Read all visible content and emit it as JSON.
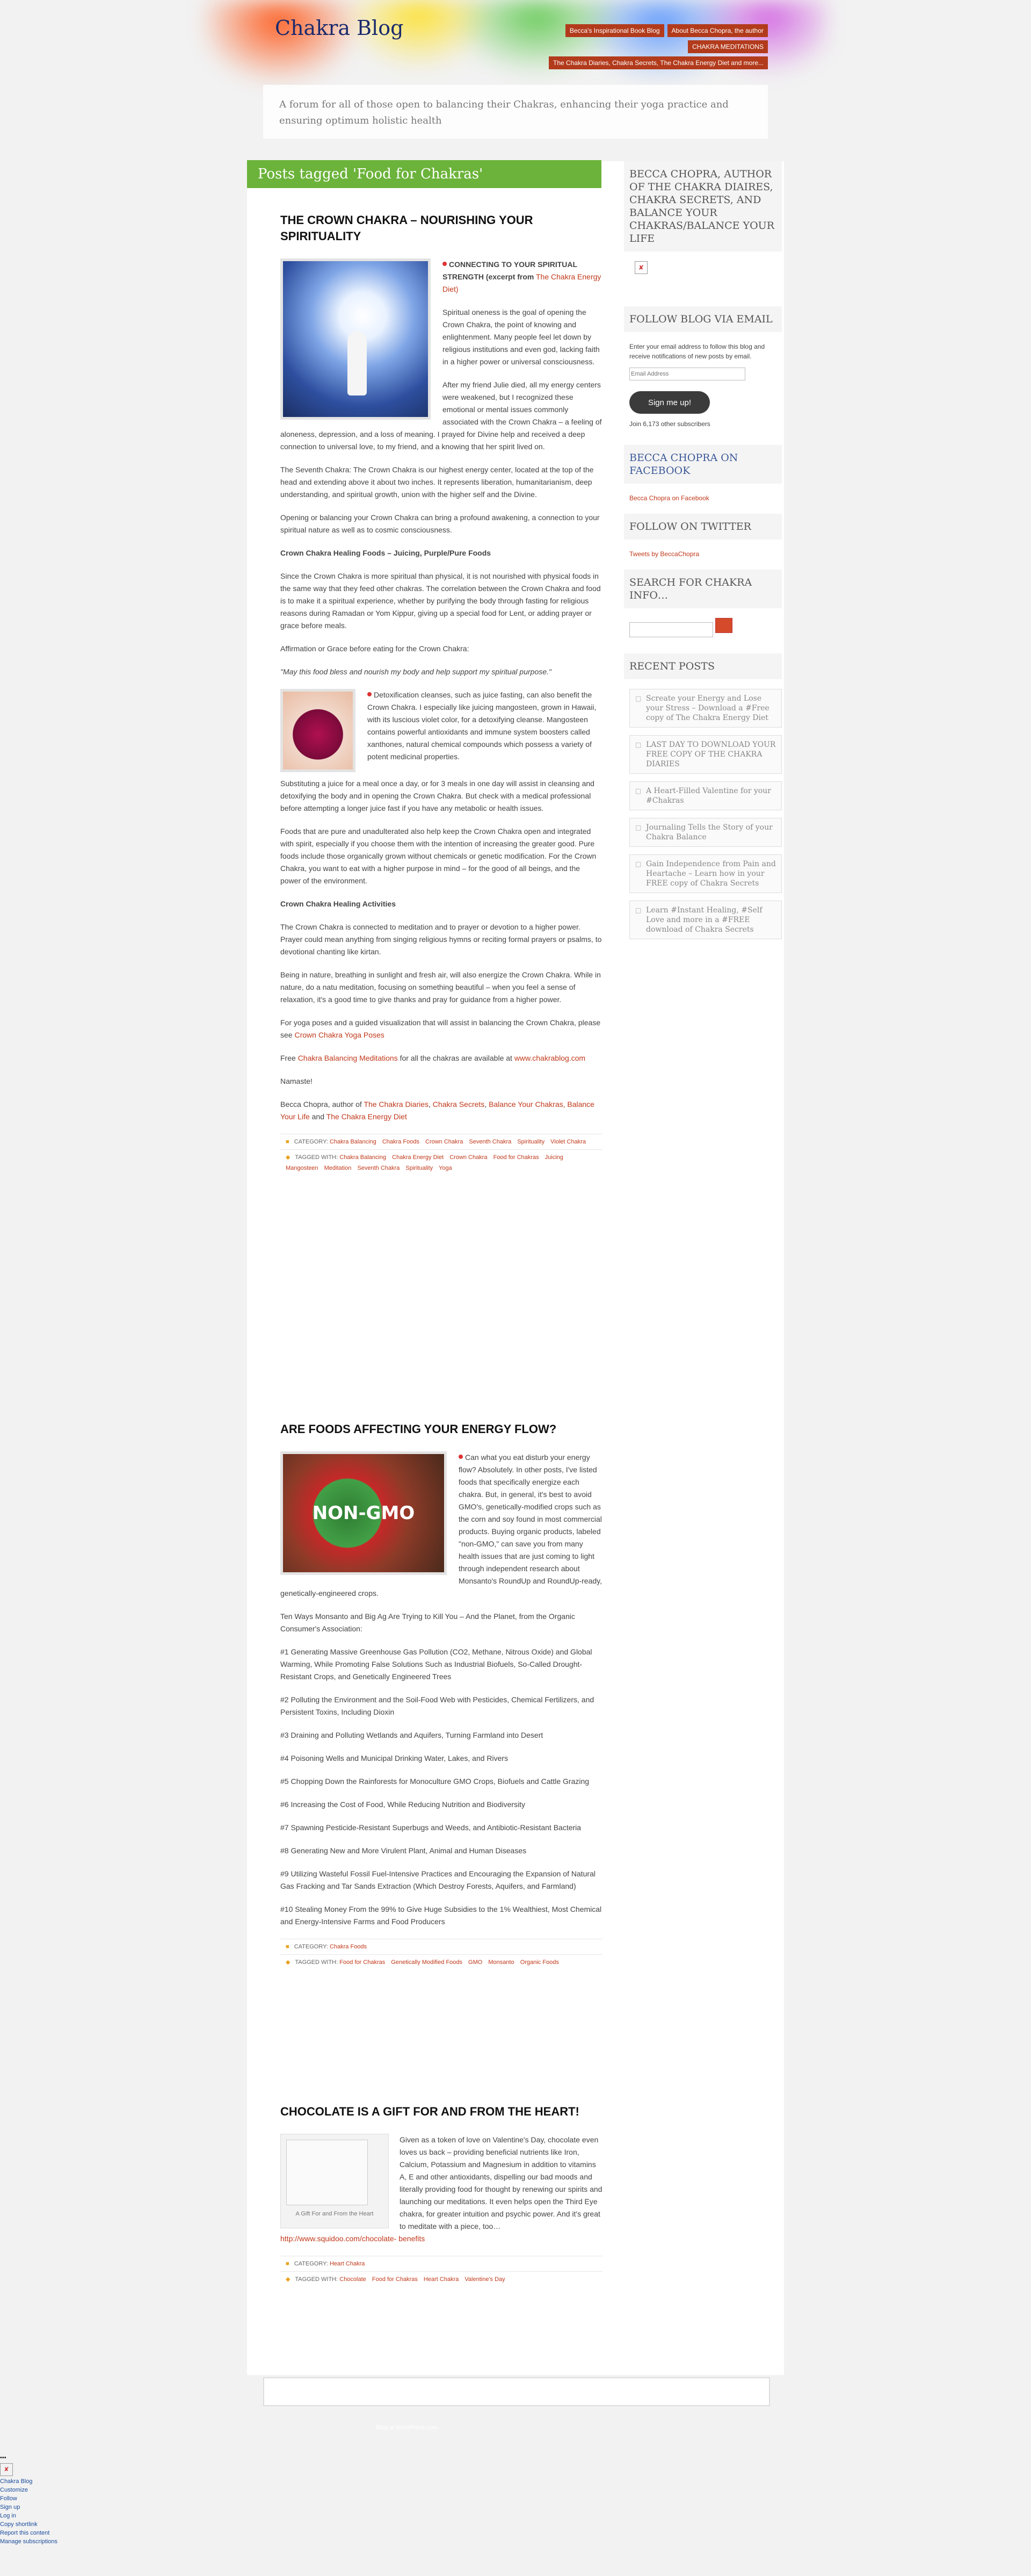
{
  "site": {
    "title": "Chakra Blog",
    "tagline": "A forum for all of those open to balancing their Chakras, enhancing their yoga practice and ensuring optimum holistic health"
  },
  "nav": [
    {
      "label": "Becca's Inspirational Book Blog"
    },
    {
      "label": "About Becca Chopra, the author"
    },
    {
      "label": "CHAKRA MEDITATIONS"
    },
    {
      "label": "The Chakra Diaries, Chakra Secrets, The Chakra Energy Diet and more..."
    }
  ],
  "archive_title": "Posts tagged 'Food for Chakras'",
  "posts": [
    {
      "title": "THE CROWN CHAKRA – NOURISHING YOUR SPIRITUALITY",
      "lead_heading": "CONNECTING TO YOUR SPIRITUAL STRENGTH (excerpt from",
      "lead_link": "The Chakra Energy Diet)",
      "paragraphs": [
        "Spiritual oneness is the goal of opening the Crown Chakra, the point of knowing and enlightenment. Many people feel let down by religious institutions and even god, lacking faith in a higher power or universal consciousness.",
        "After my friend Julie died, all my energy centers were weakened, but I recognized these emotional or mental issues commonly associated with the Crown Chakra – a feeling of aloneness, depression, and a loss of meaning. I prayed for Divine help and received a deep connection to universal love, to my friend, and a knowing that her spirit lived on.",
        "The Seventh Chakra: The Crown Chakra is our highest energy center, located at the top of the head and extending above it about two inches. It represents liberation, humanitarianism, deep understanding, and spiritual growth, union with the higher self and the Divine.",
        "Opening or balancing your Crown Chakra can bring a profound awakening, a connection to your spiritual nature as well as to cosmic consciousness.",
        "Crown Chakra Healing Foods – Juicing, Purple/Pure Foods",
        "Since the Crown Chakra is more spiritual than physical, it is not nourished with physical foods in the same way that they feed other chakras. The correlation between the Crown Chakra and food is to make it a spiritual experience, whether by purifying the body through fasting for religious reasons during Ramadan or Yom Kippur, giving up a special food for Lent, or adding prayer or grace before meals.",
        "Affirmation or Grace before eating for the Crown Chakra:",
        "\"May this food bless and nourish my body and help support my spiritual purpose.\"",
        "Detoxification cleanses, such as juice fasting, can also benefit the Crown Chakra. I especially like juicing mangosteen, grown in Hawaii, with its luscious violet color, for a detoxifying cleanse. Mangosteen contains powerful antioxidants and immune system boosters called xanthones, natural chemical compounds which possess a variety of potent medicinal properties.",
        "Substituting a juice for a meal once a day, or for 3 meals in one day will assist in cleansing and detoxifying the body and in opening the Crown Chakra. But check with a medical professional before attempting a longer juice fast if you have any metabolic or health issues.",
        "Foods that are pure and unadulterated also help keep the Crown Chakra open and integrated with spirit, especially if you choose them with the intention of increasing the greater good. Pure foods include those organically grown without chemicals or genetic modification. For the Crown Chakra, you want to eat with a higher purpose in mind – for the good of all beings, and the power of the environment.",
        "Crown Chakra Healing Activities",
        "The Crown Chakra is connected to meditation and to prayer or devotion to a higher power. Prayer could mean anything from singing religious hymns or reciting formal prayers or psalms, to devotional chanting like kirtan.",
        "Being in nature, breathing in sunlight and fresh air, will also energize the Crown Chakra. While in nature, do a natu meditation, focusing on something beautiful – when you feel a sense of relaxation, it's a good time to give thanks and pray for guidance from a higher power.",
        "For yoga poses and a guided visualization that will assist in balancing the Crown Chakra, please see"
      ],
      "yoga_link": "Crown Chakra Yoga Poses",
      "free_text": "Free",
      "free_link": "Chakra Balancing Meditations",
      "free_rest": "for all the chakras are available at",
      "free_link2": "www.chakrablog.com",
      "signoff": "Namaste!",
      "author_prefix": "Becca Chopra, author of",
      "author_links": [
        "The Chakra Diaries",
        "Chakra Secrets",
        "Balance Your Chakras, Balance Your Life",
        "The Chakra Energy Diet"
      ],
      "category_label": "CATEGORY:",
      "categories": [
        "Chakra Balancing",
        "Chakra Foods",
        "Crown Chakra",
        "Seventh Chakra",
        "Spirituality",
        "Violet Chakra"
      ],
      "tags_label": "TAGGED WITH:",
      "tags": [
        "Chakra Balancing",
        "Chakra Energy Diet",
        "Crown Chakra",
        "Food for Chakras",
        "Juicing",
        "Mangosteen",
        "Meditation",
        "Seventh Chakra",
        "Spirituality",
        "Yoga"
      ]
    },
    {
      "title": "ARE FOODS AFFECTING YOUR ENERGY FLOW?",
      "image_label": "NON-GMO",
      "paragraphs": [
        "Can what you eat disturb your energy flow? Absolutely. In other posts, I've listed foods that specifically energize each chakra. But, in general, it's best to avoid GMO's, genetically-modified crops such as the corn and soy found in most commercial products. Buying organic products, labeled \"non-GMO,\" can save you from many health issues that are just coming to light through independent research about Monsanto's RoundUp and RoundUp-ready, genetically-engineered crops.",
        "Ten Ways Monsanto and Big Ag Are Trying to Kill You – And the Planet, from the Organic Consumer's Association:",
        "#1 Generating Massive Greenhouse Gas Pollution (CO2, Methane, Nitrous Oxide) and Global Warming, While Promoting False Solutions Such as Industrial Biofuels, So-Called Drought-Resistant Crops, and Genetically Engineered Trees",
        "#2 Polluting the Environment and the Soil-Food Web with Pesticides, Chemical Fertilizers, and Persistent Toxins, Including Dioxin",
        "#3 Draining and Polluting Wetlands and Aquifers, Turning Farmland into Desert",
        "#4 Poisoning Wells and Municipal Drinking Water, Lakes, and Rivers",
        "#5 Chopping Down the Rainforests for Monoculture GMO Crops, Biofuels and Cattle Grazing",
        "#6 Increasing the Cost of Food, While Reducing Nutrition and Biodiversity",
        "#7 Spawning Pesticide-Resistant Superbugs and Weeds, and Antibiotic-Resistant Bacteria",
        "#8 Generating New and More Virulent Plant, Animal and Human Diseases",
        "#9 Utilizing Wasteful Fossil Fuel-Intensive Practices and Encouraging the Expansion of Natural Gas Fracking and Tar Sands Extraction (Which Destroy Forests, Aquifers, and Farmland)",
        "#10 Stealing Money From the 99% to Give Huge Subsidies to the 1% Wealthiest, Most Chemical and Energy-Intensive Farms and Food Producers"
      ],
      "category_label": "CATEGORY:",
      "categories": [
        "Chakra Foods"
      ],
      "tags_label": "TAGGED WITH:",
      "tags": [
        "Food for Chakras",
        "Genetically Modified Foods",
        "GMO",
        "Monsanto",
        "Organic Foods"
      ]
    },
    {
      "title": "CHOCOLATE IS A GIFT FOR AND FROM THE HEART!",
      "image_caption": "A Gift For and From the Heart",
      "body": "Given as a token of love on Valentine's Day, chocolate even loves us back – providing beneficial nutrients like Iron, Calcium, Potassium and Magnesium in addition to vitamins A, E and other antioxidants, dispelling our bad moods and literally providing food for thought by renewing our spirits and launching our meditations. It even helps open the Third Eye chakra, for greater intuition and psychic power. And it's great to meditate with a piece, too…",
      "body_link": "http://www.squidoo.com/chocolate-",
      "body_link2": "benefits",
      "category_label": "CATEGORY:",
      "categories": [
        "Heart Chakra"
      ],
      "tags_label": "TAGGED WITH:",
      "tags": [
        "Chocolate",
        "Food for Chakras",
        "Heart Chakra",
        "Valentine's Day"
      ]
    }
  ],
  "sidebar": {
    "author_widget": {
      "title": "BECCA CHOPRA, AUTHOR OF THE CHAKRA DIAIRES, CHAKRA SECRETS, AND BALANCE YOUR CHAKRAS/BALANCE YOUR LIFE"
    },
    "follow_widget": {
      "title": "FOLLOW BLOG VIA EMAIL",
      "text": "Enter your email address to follow this blog and receive notifications of new posts by email.",
      "placeholder": "Email Address",
      "button": "Sign me up!",
      "count": "Join 6,173 other subscribers"
    },
    "facebook_widget": {
      "title": "BECCA CHOPRA ON FACEBOOK",
      "link": "Becca Chopra on Facebook"
    },
    "twitter_widget": {
      "title": "FOLLOW ON TWITTER",
      "link": "Tweets by BeccaChopra"
    },
    "search_widget": {
      "title": "SEARCH FOR CHAKRA INFO…",
      "button": "Search"
    },
    "recent_widget": {
      "title": "RECENT POSTS",
      "items": [
        "Screate your Energy and Lose your Stress – Download a #Free copy of The Chakra Energy Diet",
        "LAST DAY TO DOWNLOAD YOUR FREE COPY OF THE CHAKRA DIARIES",
        "A Heart-Filled Valentine for your #Chakras",
        "Journaling Tells the Story of your Chakra Balance",
        "Gain Independence from Pain and Heartache – Learn how in your FREE copy of Chakra Secrets",
        "Learn #Instant Healing, #Self Love and more in a #FREE download of Chakra Secrets"
      ]
    }
  },
  "footer": {
    "credit": "Blog at WordPress.com."
  },
  "admin_bar": {
    "dots": "•••",
    "items": [
      "Chakra Blog",
      "Customize",
      "Sign up",
      "Log in",
      "Copy shortlink",
      "Report this content",
      "Manage subscriptions"
    ],
    "follow": "Follow"
  }
}
